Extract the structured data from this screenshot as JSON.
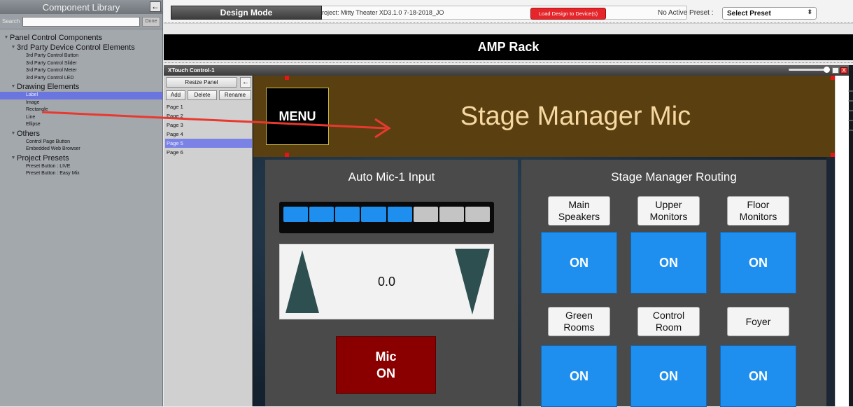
{
  "library": {
    "title": "Component Library",
    "collapse_icon": "←",
    "search_label": "Search",
    "search_value": "",
    "done_label": "Done",
    "tree": [
      {
        "type": "cat",
        "level": 0,
        "label": "Panel Control Components"
      },
      {
        "type": "cat",
        "level": 1,
        "label": "3rd Party Device Control Elements"
      },
      {
        "type": "leaf",
        "label": "3rd Party Control Button"
      },
      {
        "type": "leaf",
        "label": "3rd Party Control Slider"
      },
      {
        "type": "leaf",
        "label": "3rd Party Control Meter"
      },
      {
        "type": "leaf",
        "label": "3rd Party Control LED"
      },
      {
        "type": "cat",
        "level": 1,
        "label": "Drawing Elements"
      },
      {
        "type": "leaf",
        "label": "Label",
        "selected": true
      },
      {
        "type": "leaf",
        "label": "Image"
      },
      {
        "type": "leaf",
        "label": "Rectangle"
      },
      {
        "type": "leaf",
        "label": "Line"
      },
      {
        "type": "leaf",
        "label": "Ellipse"
      },
      {
        "type": "cat",
        "level": 1,
        "label": "Others"
      },
      {
        "type": "leaf",
        "label": "Control Page Button"
      },
      {
        "type": "leaf",
        "label": "Embedded Web Browser"
      },
      {
        "type": "cat",
        "level": 1,
        "label": "Project Presets"
      },
      {
        "type": "leaf",
        "label": "Preset Button : LIVE"
      },
      {
        "type": "leaf",
        "label": "Preset Button : Easy Mix"
      }
    ]
  },
  "toolbar": {
    "mode_label": "Design Mode",
    "project_label": "Project: Mitty Theater XD3.1.0 7-18-2018_JO",
    "load_button": "Load Design to Device(s)",
    "preset_status": "No Active Preset :",
    "preset_select": "Select Preset",
    "preset_select_arrows": "⬍"
  },
  "canvas": {
    "rack_title": "AMP Rack",
    "window_title": "XTouch Control-1",
    "close_icon": "X"
  },
  "pages": {
    "resize_label": "Resize Panel",
    "back_icon": "←",
    "add_label": "Add",
    "delete_label": "Delete",
    "rename_label": "Rename",
    "items": [
      "Page 1",
      "Page 2",
      "Page 3",
      "Page 4",
      "Page 5",
      "Page 6"
    ],
    "selected_index": 4
  },
  "panel": {
    "menu_label": "MENU",
    "title": "Stage Manager Mic",
    "left_title": "Auto Mic-1 Input",
    "meter_segments": [
      "#1e8fef",
      "#1e8fef",
      "#1e8fef",
      "#1e8fef",
      "#1e8fef",
      "#c4c4c4",
      "#c4c4c4",
      "#c4c4c4"
    ],
    "volume_value": "0.0",
    "mic_line1": "Mic",
    "mic_line2": "ON",
    "right_title": "Stage Manager Routing",
    "routes": [
      {
        "label": "Main\nSpeakers",
        "state": "ON"
      },
      {
        "label": "Upper\nMonitors",
        "state": "ON"
      },
      {
        "label": "Floor\nMonitors",
        "state": "ON"
      },
      {
        "label": "Green\nRooms",
        "state": "ON"
      },
      {
        "label": "Control\nRoom",
        "state": "ON"
      },
      {
        "label": "Foyer",
        "state": "ON"
      }
    ]
  },
  "colors": {
    "selection": "#7a83e5",
    "header_band": "#5a3f10",
    "title_text": "#f6d8a0",
    "route_on": "#1e8fef",
    "mic_on": "#8a0000",
    "arrow": "#e8392f"
  }
}
